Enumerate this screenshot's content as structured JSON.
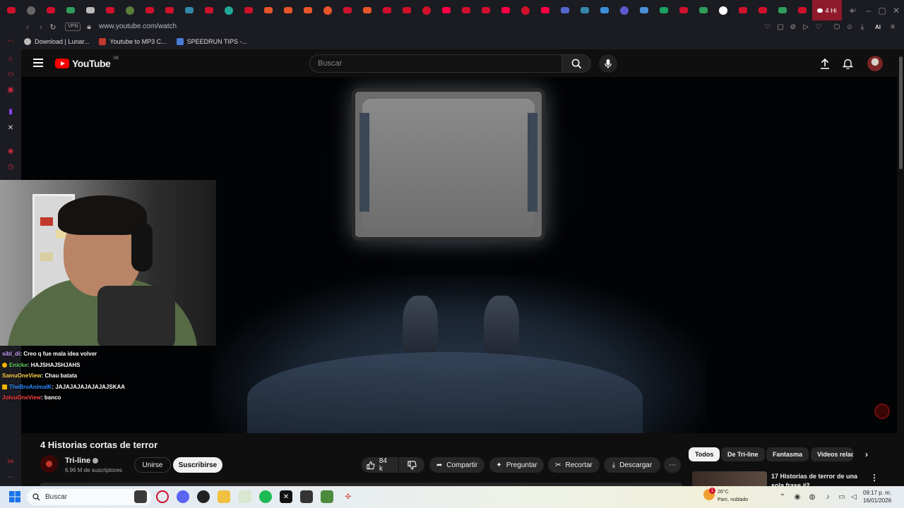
{
  "browser": {
    "active_tab_label": "4 Hi",
    "address": "www.youtube.com/watch",
    "vpn_label": "VPN",
    "ai_label": "AI",
    "bookmarks": [
      {
        "label": "Download | Lunar...",
        "color": "#bbbbbb"
      },
      {
        "label": "Youtube to MP3 C...",
        "color": "#c0392b"
      },
      {
        "label": "SPEEDRUN TIPS -...",
        "color": "#4a7cd6"
      }
    ]
  },
  "youtube": {
    "logo_text": "YouTube",
    "country_code": "VE",
    "search_placeholder": "Buscar"
  },
  "chat": [
    {
      "user": "sibl_di",
      "text": " : Creo q fue mala idea volver",
      "color": "#c9a0ff",
      "badge": ""
    },
    {
      "user": "Enicke",
      "text": " : HAJSHAJSHJAHS",
      "color": "#5fd35f",
      "badge": "#f4b400"
    },
    {
      "user": "SamuOneView",
      "text": " : Chau batata",
      "color": "#ffd24a",
      "badge": ""
    },
    {
      "user": "TheBroAnimalK",
      "text": " : JAJAJAJAJAJAJAJSKAA",
      "color": "#2d8cff",
      "badge": "#f4b400"
    },
    {
      "user": "JolouOneView",
      "text": " : banco",
      "color": "#ff4040",
      "badge": ""
    }
  ],
  "video": {
    "title": "4 Historias cortas de terror",
    "channel": "Tri-line",
    "subscribers": "6.96 M de suscriptores",
    "join_label": "Unirse",
    "subscribe_label": "Suscribirse",
    "likes": "84 k",
    "share_label": "Compartir",
    "ask_label": "Preguntar",
    "clip_label": "Recortar",
    "download_label": "Descargar"
  },
  "chips": [
    "Todos",
    "De Tri-line",
    "Fantasma",
    "Videos relac"
  ],
  "recommended": {
    "title": "17 Historias de terror de una sola frase #2"
  },
  "taskbar": {
    "search_placeholder": "Buscar",
    "temperature": "26°C",
    "weather": "Parc. nublado",
    "notification_count": "1",
    "time": "09:17 p. m.",
    "date": "16/01/2026"
  },
  "sidebar_label": "GX"
}
